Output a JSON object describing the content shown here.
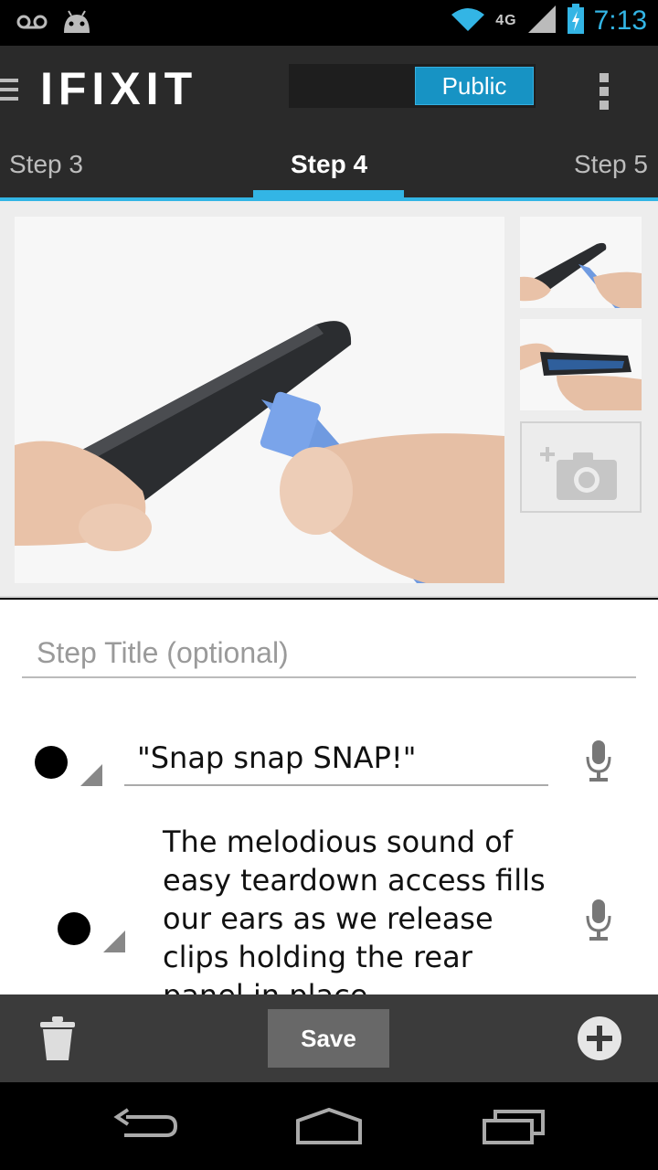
{
  "status_bar": {
    "time": "7:13",
    "network": "4G",
    "icons": [
      "voicemail-icon",
      "android-icon",
      "wifi-icon",
      "signal-icon",
      "battery-charging-icon"
    ]
  },
  "action_bar": {
    "logo": "IFIXIT",
    "visibility_label": "Public",
    "icons": [
      "menu-icon",
      "overflow-menu-icon"
    ]
  },
  "tabs": [
    {
      "label": "Step 3"
    },
    {
      "label": "Step 4",
      "active": true
    },
    {
      "label": "Step 5"
    }
  ],
  "step": {
    "title_placeholder": "Step Title (optional)",
    "title_value": "",
    "lines": [
      {
        "bullet_color": "#000000",
        "text": "\"Snap snap SNAP!\""
      },
      {
        "bullet_color": "#000000",
        "text": "The melodious sound of easy teardown access fills our ears as we release clips holding the rear panel in place."
      }
    ]
  },
  "bottom_bar": {
    "save_label": "Save",
    "icons": [
      "trash-icon",
      "add-icon"
    ]
  },
  "nav_bar": {
    "icons": [
      "back-icon",
      "home-icon",
      "recent-apps-icon"
    ]
  },
  "colors": {
    "accent": "#33b5e5",
    "public_button": "#1793c4",
    "action_bar": "#2a2a2a",
    "bottom_bar": "#3b3b3b"
  }
}
